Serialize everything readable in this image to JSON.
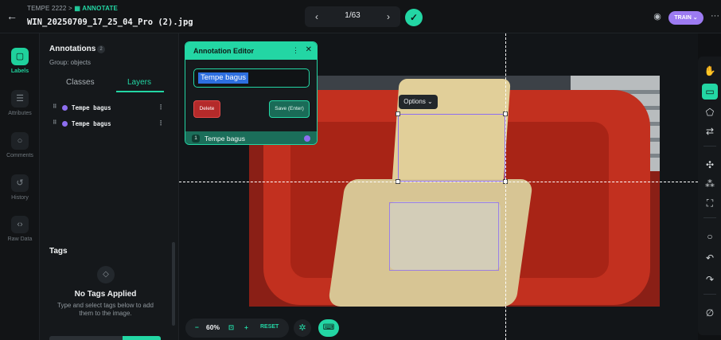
{
  "header": {
    "back_icon": "arrow-left-icon",
    "breadcrumb_project": "TEMPE 2222",
    "breadcrumb_sep": ">",
    "breadcrumb_current": "ANNOTATE",
    "filename": "WIN_20250709_17_25_04_Pro (2).jpg",
    "pager": {
      "prev": "‹",
      "current": "1/63",
      "next": "›"
    },
    "train_label": "TRAIN ⌄",
    "more": "···"
  },
  "rail": {
    "items": [
      {
        "label": "Labels",
        "icon": "label-icon",
        "active": true
      },
      {
        "label": "Attributes",
        "icon": "list-icon"
      },
      {
        "label": "Comments",
        "icon": "comment-icon"
      },
      {
        "label": "History",
        "icon": "history-icon"
      },
      {
        "label": "Raw Data",
        "icon": "code-icon"
      }
    ]
  },
  "panel": {
    "title": "Annotations",
    "count": "2",
    "group": "Group: objects",
    "tabs": {
      "classes": "Classes",
      "layers": "Layers"
    },
    "layers": [
      {
        "name": "Tempe bagus",
        "color": "#8d6ef0"
      },
      {
        "name": "Tempe bagus",
        "color": "#8d6ef0"
      }
    ],
    "tags": {
      "title": "Tags",
      "empty_title": "No Tags Applied",
      "hint": "Type and select tags below to add them to the image."
    }
  },
  "editor": {
    "title": "Annotation Editor",
    "input_value": "Tempe bagus",
    "delete_label": "Delete",
    "save_label": "Save (Enter)",
    "row_index": "1",
    "row_label": "Tempe bagus"
  },
  "canvas": {
    "options_label": "Options ⌄"
  },
  "zoom": {
    "minus": "−",
    "value": "60%",
    "plus": "+",
    "reset": "RESET"
  },
  "colors": {
    "accent": "#23d6a4",
    "class_color": "#8d6ef0",
    "train": "#9d7bf2",
    "delete": "#b42a2a"
  }
}
